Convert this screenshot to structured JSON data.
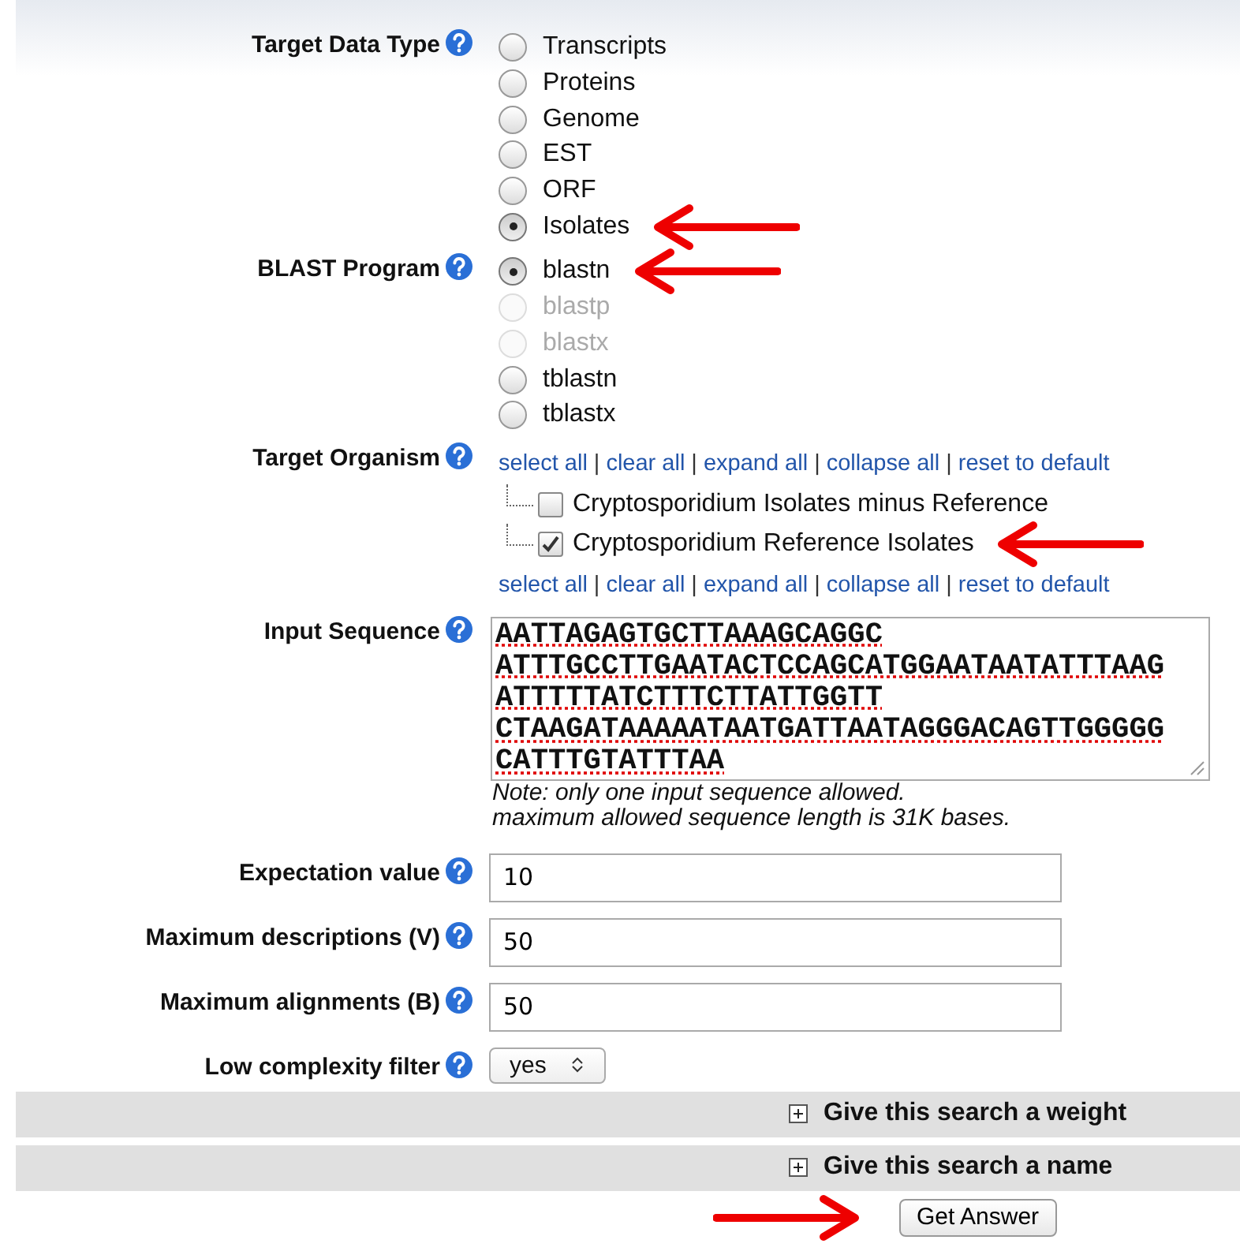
{
  "fields": [
    {
      "kind": "radio",
      "label": "Target Data Type",
      "options": [
        {
          "label": "Transcripts",
          "selected": false,
          "disabled": false,
          "annotated": false
        },
        {
          "label": "Proteins",
          "selected": false,
          "disabled": false,
          "annotated": false
        },
        {
          "label": "Genome",
          "selected": false,
          "disabled": false,
          "annotated": false
        },
        {
          "label": "EST",
          "selected": false,
          "disabled": false,
          "annotated": false
        },
        {
          "label": "ORF",
          "selected": false,
          "disabled": false,
          "annotated": false
        },
        {
          "label": "Isolates",
          "selected": true,
          "disabled": false,
          "annotated": true
        }
      ]
    },
    {
      "kind": "radio",
      "label": "BLAST Program",
      "options": [
        {
          "label": "blastn",
          "selected": true,
          "disabled": false,
          "annotated": true
        },
        {
          "label": "blastp",
          "selected": false,
          "disabled": true,
          "annotated": false
        },
        {
          "label": "blastx",
          "selected": false,
          "disabled": true,
          "annotated": false
        },
        {
          "label": "tblastn",
          "selected": false,
          "disabled": false,
          "annotated": false
        },
        {
          "label": "tblastx",
          "selected": false,
          "disabled": false,
          "annotated": false
        }
      ]
    },
    {
      "kind": "tree",
      "label": "Target Organism",
      "separator": "|",
      "links": [
        "select all",
        "clear all",
        "expand all",
        "collapse all",
        "reset to default"
      ],
      "items": [
        {
          "label": "Cryptosporidium Isolates minus Reference",
          "checked": false,
          "annotated": false
        },
        {
          "label": "Cryptosporidium Reference Isolates",
          "checked": true,
          "annotated": true
        }
      ],
      "links_below": [
        "select all",
        "clear all",
        "expand all",
        "collapse all",
        "reset to default"
      ]
    },
    {
      "kind": "sequence",
      "label": "Input Sequence",
      "value": "AATTAGAGTGCTTAAAGCAGGC\nATTTGCCTTGAATACTCCAGCATGGAATAATATTTAAG\nATTTTTATCTTTCTTATTGGTT\nCTAAGATAAAAATAATGATTAATAGGGACAGTTGGGGG\nCATTTGTATTTAA",
      "notes": [
        "Note: only one input sequence allowed.",
        "maximum allowed sequence length is 31K bases."
      ]
    },
    {
      "kind": "text",
      "label": "Expectation value",
      "value": "10"
    },
    {
      "kind": "text",
      "label": "Maximum descriptions (V)",
      "value": "50"
    },
    {
      "kind": "text",
      "label": "Maximum alignments (B)",
      "value": "50"
    },
    {
      "kind": "select",
      "label": "Low complexity filter",
      "value": "yes"
    }
  ],
  "sections": [
    {
      "title": "Give this search a weight",
      "expanded": false
    },
    {
      "title": "Give this search a name",
      "expanded": false
    }
  ],
  "submit": {
    "label": "Get Answer",
    "annotated": true
  }
}
